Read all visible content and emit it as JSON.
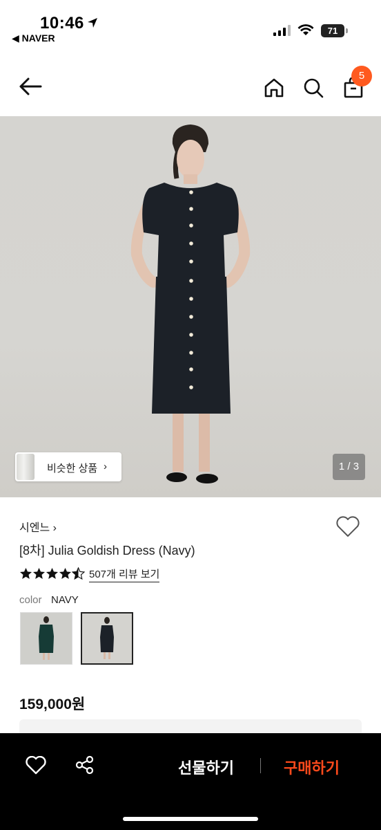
{
  "status_bar": {
    "time": "10:46",
    "back_app": "◀ NAVER",
    "battery": "71"
  },
  "nav": {
    "cart_count": "5"
  },
  "hero": {
    "similar_label": "비슷한 상품",
    "similar_chevron": "›",
    "counter": "1 / 3"
  },
  "product": {
    "brand": "시엔느 ›",
    "title": "[8차] Julia Goldish Dress (Navy)",
    "rating": 4.5,
    "review_link": "507개 리뷰 보기",
    "color_label": "color",
    "color_value": "NAVY",
    "price": "159,000원"
  },
  "bottom_bar": {
    "gift_label": "선물하기",
    "buy_label": "구매하기"
  },
  "colors": {
    "accent": "#ff5a1f",
    "buy": "#ff4a1c",
    "dress": "#1c2128"
  },
  "icons": [
    "location-arrow-icon",
    "signal-icon",
    "wifi-icon",
    "back-arrow-icon",
    "home-icon",
    "search-icon",
    "shopping-bag-icon",
    "heart-icon",
    "share-icon",
    "star-icon"
  ]
}
